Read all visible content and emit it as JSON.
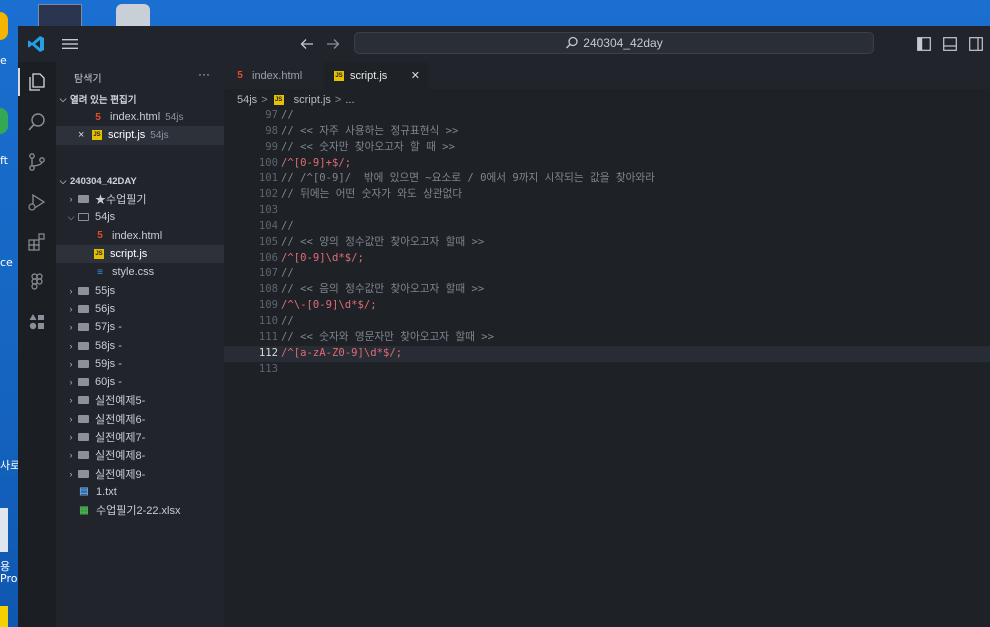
{
  "desktop": {
    "labels": [
      "e",
      "ft",
      "ce",
      "사로",
      "용",
      "Pro"
    ]
  },
  "titlebar": {
    "search_text": "240304_42day",
    "back_icon": "arrow-left-icon",
    "forward_icon": "arrow-right-icon"
  },
  "sidebar": {
    "title": "탐색기",
    "more_label": "···",
    "open_editors": {
      "header": "열려 있는 편집기",
      "items": [
        {
          "name": "index.html",
          "dir": "54js",
          "type": "html"
        },
        {
          "name": "script.js",
          "dir": "54js",
          "type": "js",
          "close": "×"
        }
      ]
    },
    "workspace": {
      "header": "240304_42DAY",
      "items": [
        {
          "name": "★수업필기",
          "kind": "folder",
          "depth": 0,
          "open": false
        },
        {
          "name": "54js",
          "kind": "folder",
          "depth": 0,
          "open": true
        },
        {
          "name": "index.html",
          "kind": "html",
          "depth": 1
        },
        {
          "name": "script.js",
          "kind": "js",
          "depth": 1
        },
        {
          "name": "style.css",
          "kind": "css",
          "depth": 1
        },
        {
          "name": "55js",
          "kind": "folder",
          "depth": 0,
          "open": false
        },
        {
          "name": "56js",
          "kind": "folder",
          "depth": 0,
          "open": false
        },
        {
          "name": "57js -",
          "kind": "folder",
          "depth": 0,
          "open": false
        },
        {
          "name": "58js -",
          "kind": "folder",
          "depth": 0,
          "open": false
        },
        {
          "name": "59js -",
          "kind": "folder",
          "depth": 0,
          "open": false
        },
        {
          "name": "60js -",
          "kind": "folder",
          "depth": 0,
          "open": false
        },
        {
          "name": "실전예제5-",
          "kind": "folder",
          "depth": 0,
          "open": false
        },
        {
          "name": "실전예제6-",
          "kind": "folder",
          "depth": 0,
          "open": false
        },
        {
          "name": "실전예제7-",
          "kind": "folder",
          "depth": 0,
          "open": false
        },
        {
          "name": "실전예제8-",
          "kind": "folder",
          "depth": 0,
          "open": false
        },
        {
          "name": "실전예제9-",
          "kind": "folder",
          "depth": 0,
          "open": false
        },
        {
          "name": "1.txt",
          "kind": "txt",
          "depth": 0
        },
        {
          "name": "수업필기2-22.xlsx",
          "kind": "xlsx",
          "depth": 0
        }
      ]
    }
  },
  "tabs": [
    {
      "label": "index.html",
      "type": "html",
      "active": false
    },
    {
      "label": "script.js",
      "type": "js",
      "active": true,
      "close": "✕"
    }
  ],
  "breadcrumb": {
    "folder": "54js",
    "sep": ">",
    "file": "script.js",
    "more": "..."
  },
  "code": {
    "current_line": 112,
    "lines": [
      {
        "n": 97,
        "text": "//",
        "kind": "comment"
      },
      {
        "n": 98,
        "text": "// << 자주 사용하는 정규표현식 >>",
        "kind": "comment"
      },
      {
        "n": 99,
        "text": "// << 숫자만 찾아오고자 할 때 >>",
        "kind": "comment"
      },
      {
        "n": 100,
        "text": "/^[0-9]+$/;",
        "kind": "regex"
      },
      {
        "n": 101,
        "text": "// /^[0-9]/  밖에 있으면 ~요소로 / 0에서 9까지 시작되는 값을 찾아와라",
        "kind": "comment"
      },
      {
        "n": 102,
        "text": "// 뒤에는 어떤 숫자가 와도 상관없다",
        "kind": "comment"
      },
      {
        "n": 103,
        "text": "",
        "kind": "blank"
      },
      {
        "n": 104,
        "text": "//",
        "kind": "comment"
      },
      {
        "n": 105,
        "text": "// << 양의 정수값만 찾아오고자 할때 >>",
        "kind": "comment"
      },
      {
        "n": 106,
        "text": "/^[0-9]\\d*$/;",
        "kind": "regex"
      },
      {
        "n": 107,
        "text": "//",
        "kind": "comment"
      },
      {
        "n": 108,
        "text": "// << 음의 정수값만 찾아오고자 할때 >>",
        "kind": "comment"
      },
      {
        "n": 109,
        "text": "/^\\-[0-9]\\d*$/;",
        "kind": "regex"
      },
      {
        "n": 110,
        "text": "//",
        "kind": "comment"
      },
      {
        "n": 111,
        "text": "// << 숫자와 영문자만 찾아오고자 할때 >>",
        "kind": "comment"
      },
      {
        "n": 112,
        "text": "/^[a-zA-Z0-9]\\d*$/;",
        "kind": "regex"
      },
      {
        "n": 113,
        "text": "",
        "kind": "blank"
      }
    ]
  },
  "colors": {
    "accent_blue": "#23a0e6",
    "regex": "#e06c75",
    "comment": "#7f848e"
  }
}
